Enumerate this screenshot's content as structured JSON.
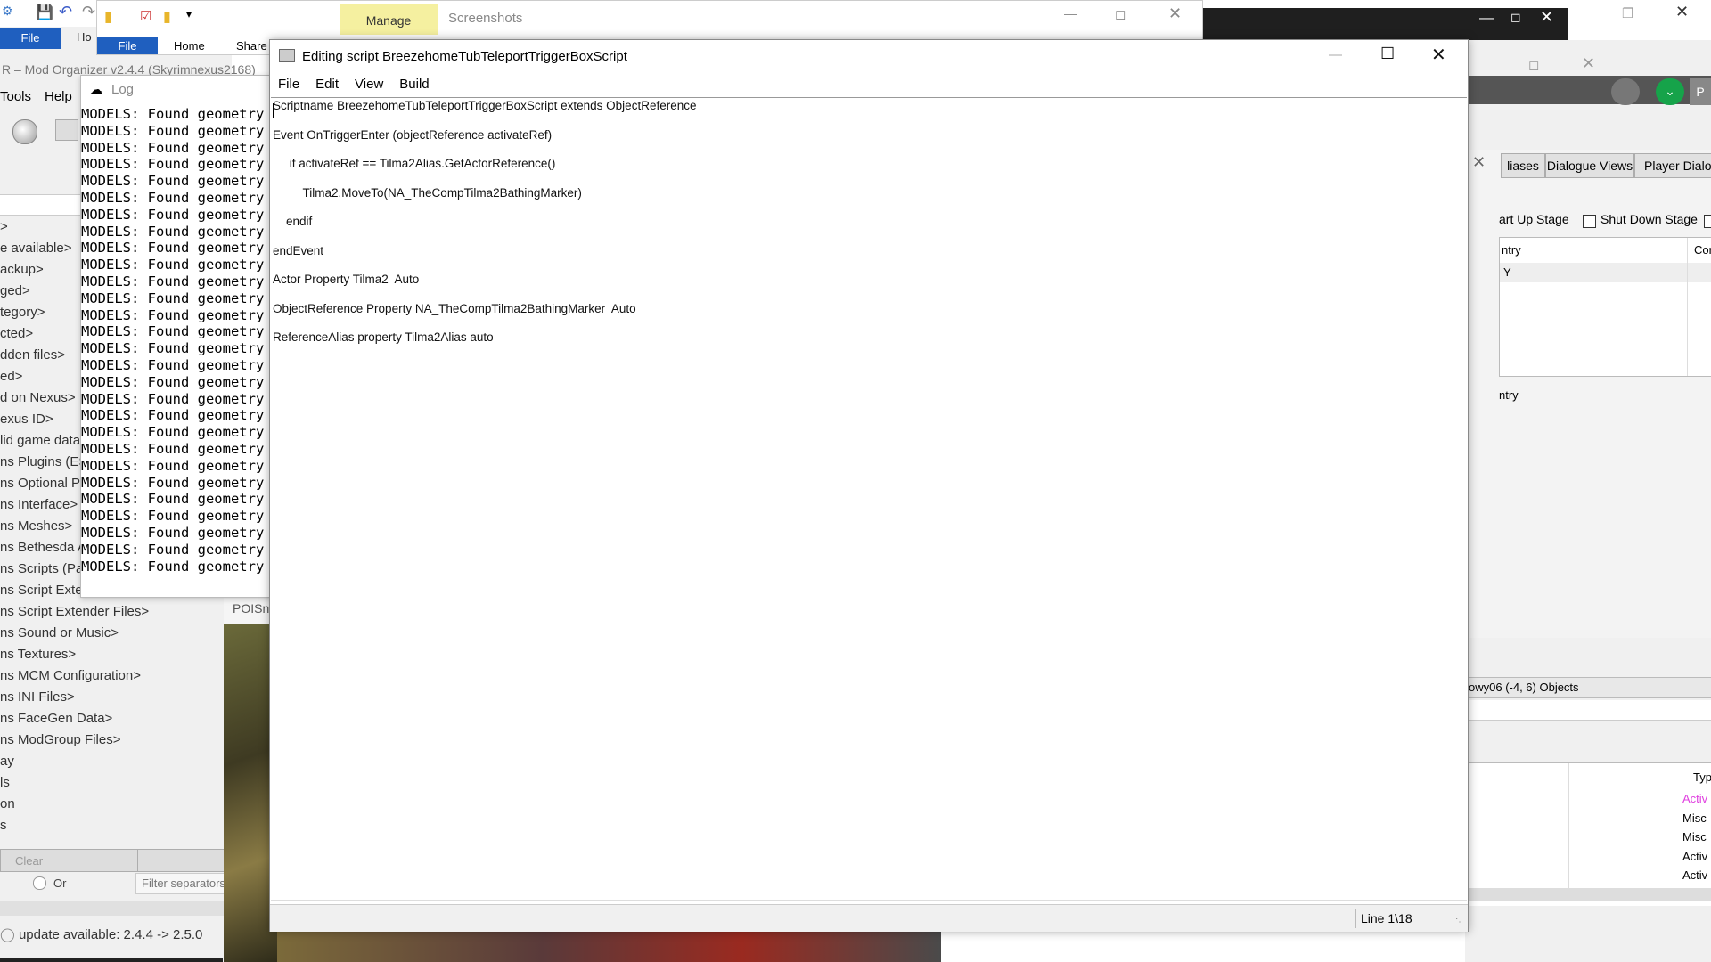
{
  "background": {
    "mo_title": "R – Mod Organizer v2.4.4 (Skyrimnexus2168)",
    "mo_file_tab": "File",
    "mo_home_tab": "Ho",
    "mo_menu": [
      "Tools",
      "Help"
    ],
    "mo_category_items": [
      ">",
      "e available>",
      "ackup>",
      "ged>",
      "tegory>",
      "cted>",
      "dden files>",
      "ed>",
      "d on Nexus>",
      "exus ID>",
      "lid game data",
      "ns Plugins (ES",
      "ns Optional P",
      "ns Interface>",
      "ns Meshes>",
      "ns Bethesda A",
      "ns Scripts (Pa",
      "ns Script Exten",
      "ns Script Extender Files>",
      "ns Sound or Music>",
      "ns Textures>",
      "ns MCM Configuration>",
      "ns INI Files>",
      "ns FaceGen Data>",
      "ns ModGroup Files>",
      "ay",
      "ls",
      "on",
      "s"
    ],
    "mo_clear_button": "Clear",
    "mo_or_label": "Or",
    "mo_filter_placeholder": "Filter separators",
    "mo_update_status": "update available: 2.4.4 -> 2.5.0",
    "log_title": "Log",
    "log_line_text": "MODELS: Found geometry '",
    "log_line_count": 28,
    "explorer_manage": "Manage",
    "explorer_screenshots": "Screenshots",
    "explorer_tabs": [
      "File",
      "Home",
      "Share"
    ],
    "poi_title": "POISn",
    "ck_tabs": [
      "liases",
      "Dialogue Views",
      "Player Dialog"
    ],
    "ck_stage_labels": [
      "art Up Stage",
      "Shut Down Stage"
    ],
    "ck_col_headers": [
      "ntry",
      "Cor"
    ],
    "ck_row_text": "Y",
    "ck_try_label": "ntry",
    "ck_cell_header": "owy06 (-4, 6) Objects",
    "ck_type_header": "Typ",
    "ck_types": [
      {
        "text": "Activ",
        "color": "#e040e0"
      },
      {
        "text": "Misc",
        "color": "#000000"
      },
      {
        "text": "Misc",
        "color": "#000000"
      },
      {
        "text": "Activ",
        "color": "#000000"
      },
      {
        "text": "Activ",
        "color": "#000000"
      }
    ],
    "ck_p_button": "P"
  },
  "editor": {
    "title": "Editing script BreezehomeTubTeleportTriggerBoxScript",
    "menu": [
      "File",
      "Edit",
      "View",
      "Build"
    ],
    "code_lines": [
      "Scriptname BreezehomeTubTeleportTriggerBoxScript extends ObjectReference",
      "Event OnTriggerEnter (objectReference activateRef)",
      "     if activateRef == Tilma2Alias.GetActorReference()",
      "         Tilma2.MoveTo(NA_TheCompTilma2BathingMarker)",
      "    endif",
      "endEvent",
      "Actor Property Tilma2  Auto",
      "ObjectReference Property NA_TheCompTilma2BathingMarker  Auto",
      "ReferenceAlias property Tilma2Alias auto"
    ],
    "status_position": "Line 1\\18"
  }
}
